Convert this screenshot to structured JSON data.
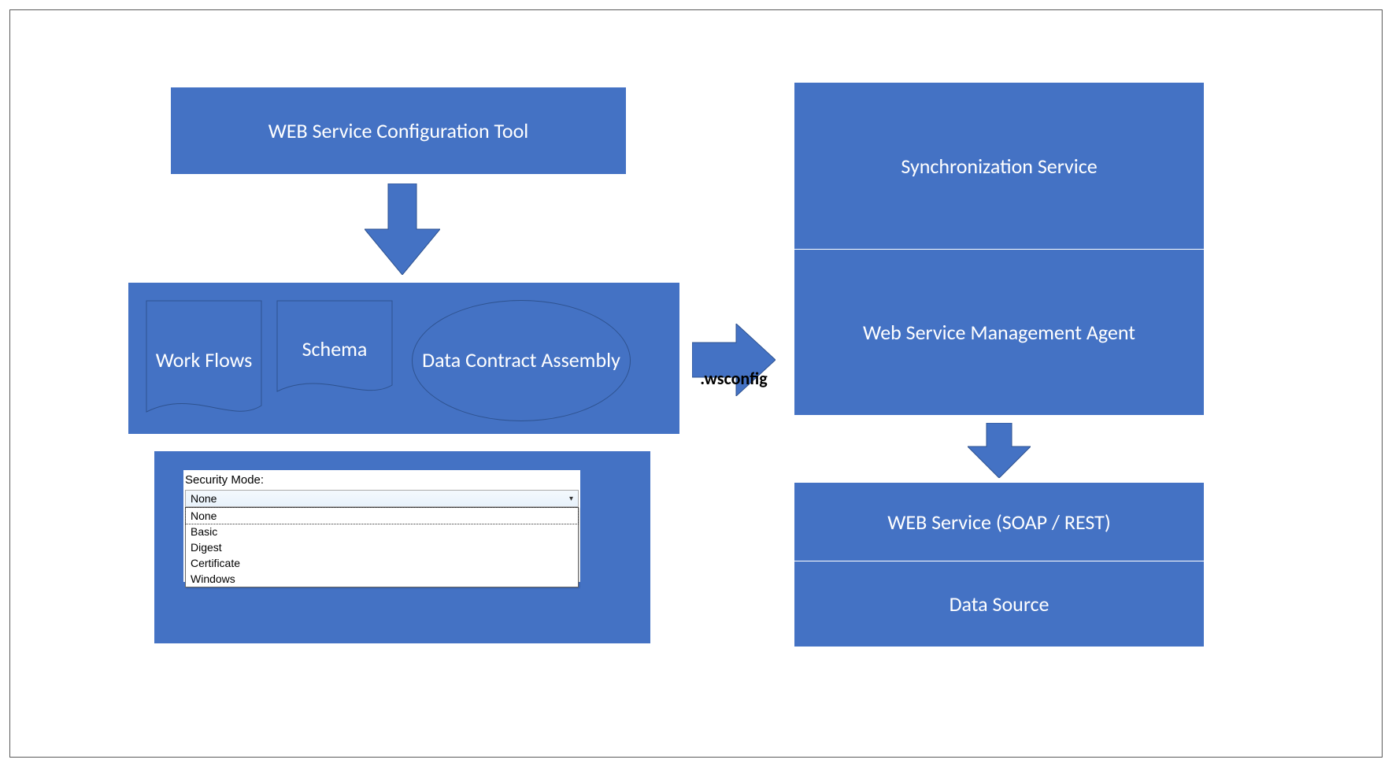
{
  "config_tool": {
    "title": "WEB Service Configuration Tool"
  },
  "components": {
    "workflows": "Work Flows",
    "schema": "Schema",
    "data_contract_assembly": "Data Contract Assembly"
  },
  "wsconfig_label": ".wsconfig",
  "sync_service": "Synchronization Service",
  "management_agent": "Web Service Management Agent",
  "soap_rest": "WEB Service (SOAP / REST)",
  "data_source": "Data Source",
  "security": {
    "label": "Security Mode:",
    "selected": "None",
    "options": [
      "None",
      "Basic",
      "Digest",
      "Certificate",
      "Windows"
    ]
  },
  "colors": {
    "box_fill": "#4472C4",
    "box_stroke": "#2E528F"
  }
}
